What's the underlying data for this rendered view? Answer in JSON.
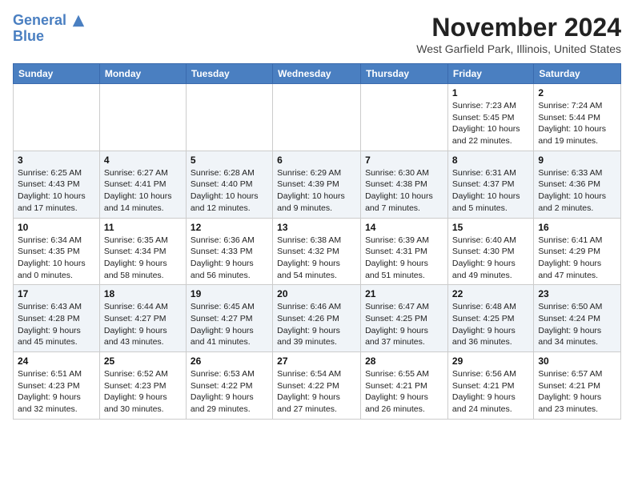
{
  "header": {
    "logo_line1": "General",
    "logo_line2": "Blue",
    "month_title": "November 2024",
    "location": "West Garfield Park, Illinois, United States"
  },
  "weekdays": [
    "Sunday",
    "Monday",
    "Tuesday",
    "Wednesday",
    "Thursday",
    "Friday",
    "Saturday"
  ],
  "weeks": [
    [
      {
        "day": "",
        "info": ""
      },
      {
        "day": "",
        "info": ""
      },
      {
        "day": "",
        "info": ""
      },
      {
        "day": "",
        "info": ""
      },
      {
        "day": "",
        "info": ""
      },
      {
        "day": "1",
        "info": "Sunrise: 7:23 AM\nSunset: 5:45 PM\nDaylight: 10 hours\nand 22 minutes."
      },
      {
        "day": "2",
        "info": "Sunrise: 7:24 AM\nSunset: 5:44 PM\nDaylight: 10 hours\nand 19 minutes."
      }
    ],
    [
      {
        "day": "3",
        "info": "Sunrise: 6:25 AM\nSunset: 4:43 PM\nDaylight: 10 hours\nand 17 minutes."
      },
      {
        "day": "4",
        "info": "Sunrise: 6:27 AM\nSunset: 4:41 PM\nDaylight: 10 hours\nand 14 minutes."
      },
      {
        "day": "5",
        "info": "Sunrise: 6:28 AM\nSunset: 4:40 PM\nDaylight: 10 hours\nand 12 minutes."
      },
      {
        "day": "6",
        "info": "Sunrise: 6:29 AM\nSunset: 4:39 PM\nDaylight: 10 hours\nand 9 minutes."
      },
      {
        "day": "7",
        "info": "Sunrise: 6:30 AM\nSunset: 4:38 PM\nDaylight: 10 hours\nand 7 minutes."
      },
      {
        "day": "8",
        "info": "Sunrise: 6:31 AM\nSunset: 4:37 PM\nDaylight: 10 hours\nand 5 minutes."
      },
      {
        "day": "9",
        "info": "Sunrise: 6:33 AM\nSunset: 4:36 PM\nDaylight: 10 hours\nand 2 minutes."
      }
    ],
    [
      {
        "day": "10",
        "info": "Sunrise: 6:34 AM\nSunset: 4:35 PM\nDaylight: 10 hours\nand 0 minutes."
      },
      {
        "day": "11",
        "info": "Sunrise: 6:35 AM\nSunset: 4:34 PM\nDaylight: 9 hours\nand 58 minutes."
      },
      {
        "day": "12",
        "info": "Sunrise: 6:36 AM\nSunset: 4:33 PM\nDaylight: 9 hours\nand 56 minutes."
      },
      {
        "day": "13",
        "info": "Sunrise: 6:38 AM\nSunset: 4:32 PM\nDaylight: 9 hours\nand 54 minutes."
      },
      {
        "day": "14",
        "info": "Sunrise: 6:39 AM\nSunset: 4:31 PM\nDaylight: 9 hours\nand 51 minutes."
      },
      {
        "day": "15",
        "info": "Sunrise: 6:40 AM\nSunset: 4:30 PM\nDaylight: 9 hours\nand 49 minutes."
      },
      {
        "day": "16",
        "info": "Sunrise: 6:41 AM\nSunset: 4:29 PM\nDaylight: 9 hours\nand 47 minutes."
      }
    ],
    [
      {
        "day": "17",
        "info": "Sunrise: 6:43 AM\nSunset: 4:28 PM\nDaylight: 9 hours\nand 45 minutes."
      },
      {
        "day": "18",
        "info": "Sunrise: 6:44 AM\nSunset: 4:27 PM\nDaylight: 9 hours\nand 43 minutes."
      },
      {
        "day": "19",
        "info": "Sunrise: 6:45 AM\nSunset: 4:27 PM\nDaylight: 9 hours\nand 41 minutes."
      },
      {
        "day": "20",
        "info": "Sunrise: 6:46 AM\nSunset: 4:26 PM\nDaylight: 9 hours\nand 39 minutes."
      },
      {
        "day": "21",
        "info": "Sunrise: 6:47 AM\nSunset: 4:25 PM\nDaylight: 9 hours\nand 37 minutes."
      },
      {
        "day": "22",
        "info": "Sunrise: 6:48 AM\nSunset: 4:25 PM\nDaylight: 9 hours\nand 36 minutes."
      },
      {
        "day": "23",
        "info": "Sunrise: 6:50 AM\nSunset: 4:24 PM\nDaylight: 9 hours\nand 34 minutes."
      }
    ],
    [
      {
        "day": "24",
        "info": "Sunrise: 6:51 AM\nSunset: 4:23 PM\nDaylight: 9 hours\nand 32 minutes."
      },
      {
        "day": "25",
        "info": "Sunrise: 6:52 AM\nSunset: 4:23 PM\nDaylight: 9 hours\nand 30 minutes."
      },
      {
        "day": "26",
        "info": "Sunrise: 6:53 AM\nSunset: 4:22 PM\nDaylight: 9 hours\nand 29 minutes."
      },
      {
        "day": "27",
        "info": "Sunrise: 6:54 AM\nSunset: 4:22 PM\nDaylight: 9 hours\nand 27 minutes."
      },
      {
        "day": "28",
        "info": "Sunrise: 6:55 AM\nSunset: 4:21 PM\nDaylight: 9 hours\nand 26 minutes."
      },
      {
        "day": "29",
        "info": "Sunrise: 6:56 AM\nSunset: 4:21 PM\nDaylight: 9 hours\nand 24 minutes."
      },
      {
        "day": "30",
        "info": "Sunrise: 6:57 AM\nSunset: 4:21 PM\nDaylight: 9 hours\nand 23 minutes."
      }
    ]
  ]
}
